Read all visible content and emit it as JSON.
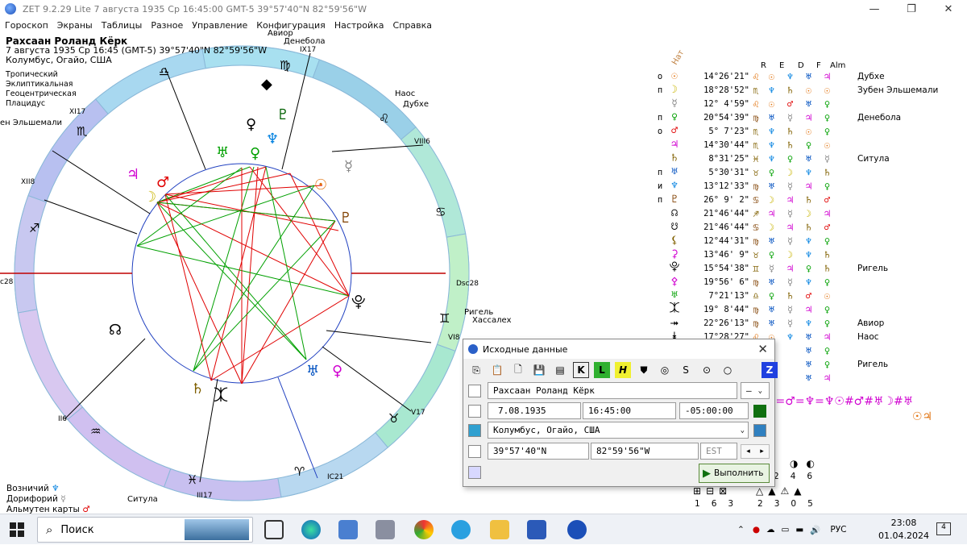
{
  "window": {
    "title": "ZET 9.2.29 Lite     7 августа 1935  Ср  16:45:00 GMT-5 39°57'40\"N  82°59'56\"W",
    "minimize": "—",
    "maximize": "❐",
    "close": "✕"
  },
  "menu": [
    "Гороскоп",
    "Экраны",
    "Таблицы",
    "Разное",
    "Управление",
    "Конфигурация",
    "Настройка",
    "Справка"
  ],
  "info": {
    "name": "Рахсаан Роланд Кёрк",
    "datetime": "7 августа 1935  Ср  16:45 (GMT-5) 39°57'40\"N  82°59'56\"W",
    "place": "Колумбус, Огайо, США",
    "zodiac": "Тропический",
    "coords": "Эклиптикальная",
    "center": "Геоцентрическая",
    "houses": "Плацидус"
  },
  "bottom_info": {
    "vozn": "Возничий",
    "dor": "Дорифорий",
    "alm": "Альмутен карты",
    "situla": "Ситула"
  },
  "chart_labels": {
    "aviour": "Авиор",
    "deneb": "Денебола",
    "naos": "Наос",
    "dubhe": "Дубхе",
    "zuben": "ен Эльшемали",
    "rigel": "Ригель",
    "hassaleh": "Хассалех",
    "asc": "c28",
    "dsc": "Dsc28",
    "ix": "IX17",
    "viii": "VIII6",
    "xi": "XI17",
    "xii": "XII8",
    "vi": "VI8",
    "v": "V17",
    "iii": "III17",
    "ii": "II6",
    "ic": "IC21"
  },
  "table": {
    "header_nat": "Нат",
    "header_cols": [
      "R",
      "E",
      "D",
      "F",
      "Alm"
    ],
    "rows": [
      {
        "s": "о",
        "g": "☉",
        "c": "#e0700a",
        "pos": "14°26'21\"",
        "z": "♌",
        "cols": [
          "☉",
          "♆",
          "♅",
          "♃"
        ],
        "star": "Дубхе"
      },
      {
        "s": "п",
        "g": "☽",
        "c": "#c8b400",
        "pos": "18°28'52\"",
        "z": "♏",
        "cols": [
          "♆",
          "♄",
          "☉",
          "☉"
        ],
        "star": "Зубен Эльшемали"
      },
      {
        "s": "",
        "g": "☿",
        "c": "#888",
        "pos": "12° 4'59\"",
        "z": "♌",
        "cols": [
          "☉",
          "♂",
          "♅",
          "♀"
        ],
        "star": ""
      },
      {
        "s": "п",
        "g": "♀",
        "c": "#00a000",
        "pos": "20°54'39\"",
        "z": "♍",
        "cols": [
          "♅",
          "☿",
          "♃",
          "♀"
        ],
        "star": "Денебола"
      },
      {
        "s": "о",
        "g": "♂",
        "c": "#e00000",
        "pos": "5° 7'23\"",
        "z": "♏",
        "cols": [
          "♆",
          "♄",
          "☉",
          "♀"
        ],
        "star": ""
      },
      {
        "s": "",
        "g": "♃",
        "c": "#d000d0",
        "pos": "14°30'44\"",
        "z": "♏",
        "cols": [
          "♆",
          "♄",
          "♀",
          "☉"
        ],
        "star": ""
      },
      {
        "s": "",
        "g": "♄",
        "c": "#806000",
        "pos": "8°31'25\"",
        "z": "♓",
        "cols": [
          "♆",
          "♀",
          "♅",
          "☿"
        ],
        "star": "Ситула"
      },
      {
        "s": "п",
        "g": "♅",
        "c": "#0050c0",
        "pos": "5°30'31\"",
        "z": "♉",
        "cols": [
          "♀",
          "☽",
          "♆",
          "♄"
        ],
        "star": ""
      },
      {
        "s": "и",
        "g": "♆",
        "c": "#0080e0",
        "pos": "13°12'33\"",
        "z": "♍",
        "cols": [
          "♅",
          "☿",
          "♃",
          "♀"
        ],
        "star": ""
      },
      {
        "s": "п",
        "g": "♇",
        "c": "#804000",
        "pos": "26° 9' 2\"",
        "z": "♋",
        "cols": [
          "☽",
          "♃",
          "♄",
          "♂"
        ],
        "star": ""
      },
      {
        "s": "",
        "g": "☊",
        "c": "#000",
        "pos": "21°46'44\"",
        "z": "♐",
        "cols": [
          "♃",
          "☿",
          "☽",
          "♃"
        ],
        "star": ""
      },
      {
        "s": "",
        "g": "☋",
        "c": "#000",
        "pos": "21°46'44\"",
        "z": "♋",
        "cols": [
          "☽",
          "♃",
          "♄",
          "♂"
        ],
        "star": ""
      },
      {
        "s": "",
        "g": "⚸",
        "c": "#806000",
        "pos": "12°44'31\"",
        "z": "♍",
        "cols": [
          "♅",
          "☿",
          "♆",
          "♀"
        ],
        "star": ""
      },
      {
        "s": "",
        "g": "⚳",
        "c": "#d000d0",
        "pos": "13°46' 9\"",
        "z": "♉",
        "cols": [
          "♀",
          "☽",
          "♆",
          "♄"
        ],
        "star": ""
      },
      {
        "s": "",
        "g": "⯓",
        "c": "#000",
        "pos": "15°54'38\"",
        "z": "♊",
        "cols": [
          "☿",
          "♃",
          "♀",
          "♄"
        ],
        "star": "Ригель"
      },
      {
        "s": "",
        "g": "⚴",
        "c": "#d000d0",
        "pos": "19°56' 6\"",
        "z": "♍",
        "cols": [
          "♅",
          "☿",
          "♆",
          "♀"
        ],
        "star": ""
      },
      {
        "s": "",
        "g": "♅",
        "c": "#00a000",
        "pos": "7°21'13\"",
        "z": "♎",
        "cols": [
          "♀",
          "♄",
          "♂",
          "☉"
        ],
        "star": ""
      },
      {
        "s": "",
        "g": "⯰",
        "c": "#000",
        "pos": "19° 8'44\"",
        "z": "♍",
        "cols": [
          "♅",
          "☿",
          "♃",
          "♀"
        ],
        "star": ""
      },
      {
        "s": "",
        "g": "⯮",
        "c": "#000",
        "pos": "22°26'13\"",
        "z": "♍",
        "cols": [
          "♅",
          "☿",
          "♆",
          "♀"
        ],
        "star": "Авиор"
      },
      {
        "s": "",
        "g": "⯯",
        "c": "#000",
        "pos": "17°28'27\"",
        "z": "♌",
        "cols": [
          "☉",
          "♆",
          "♅",
          "♃"
        ],
        "star": "Наос"
      },
      {
        "s": "",
        "g": "",
        "c": "#000",
        "pos": "",
        "z": "",
        "cols": [
          "",
          "",
          "♅",
          "♀"
        ],
        "star": ""
      },
      {
        "s": "",
        "g": "",
        "c": "#000",
        "pos": "",
        "z": "",
        "cols": [
          "",
          "",
          "♅",
          "♀"
        ],
        "star": "Ригель"
      },
      {
        "s": "",
        "g": "",
        "c": "#000",
        "pos": "",
        "z": "",
        "cols": [
          "",
          "",
          "♅",
          "♃"
        ],
        "star": ""
      }
    ],
    "formula": "☽=♂=♆=♆☉#♂#♅☽#♅",
    "formula2": "☉♃",
    "circles": [
      "◑",
      "◐"
    ],
    "nums1": [
      "2",
      "4",
      "6"
    ],
    "shapes1": [
      "⊞",
      "⊟",
      "⊠"
    ],
    "shapes2": [
      "△",
      "▲",
      "⚠",
      "▲"
    ],
    "nums2": [
      "1",
      "6",
      "3"
    ],
    "nums3": [
      "2",
      "3",
      "0",
      "5"
    ]
  },
  "dialog": {
    "title": "Исходные данные",
    "name": "Рахсаан Роланд Кёрк",
    "gender": "—",
    "date": "7.08.1935",
    "time": "16:45:00",
    "tz": "-05:00:00",
    "place": "Колумбус, Огайо, США",
    "lat": "39°57'40\"N",
    "lon": "82°59'56\"W",
    "zone": "EST",
    "run": "Выполнить"
  },
  "taskbar": {
    "search": "Поиск",
    "lang": "РУС",
    "time": "23:08",
    "date": "01.04.2024",
    "notif": "4"
  },
  "colors": {
    "sun": "#e0700a",
    "moon": "#c8b400",
    "mars": "#e00000",
    "venus": "#00a000",
    "jupiter": "#d000d0",
    "uranus": "#0050c0",
    "neptune": "#0080e0"
  }
}
